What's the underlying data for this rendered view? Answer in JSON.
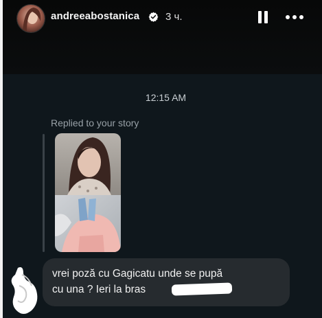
{
  "story": {
    "username": "andreeabostanica",
    "time_ago": "3 ч.",
    "verified": true,
    "icons": {
      "verified": "verified-badge-icon",
      "pause": "pause-icon",
      "more": "more-options-icon"
    }
  },
  "chat": {
    "timestamp": "12:15 AM",
    "replied_label": "Replied to your story",
    "message": "vrei poză cu Gagicatu unde se pupă\ncu una ? Ieri la bras",
    "colors": {
      "bubble": "#262b2f",
      "background": "#0f171c"
    }
  }
}
